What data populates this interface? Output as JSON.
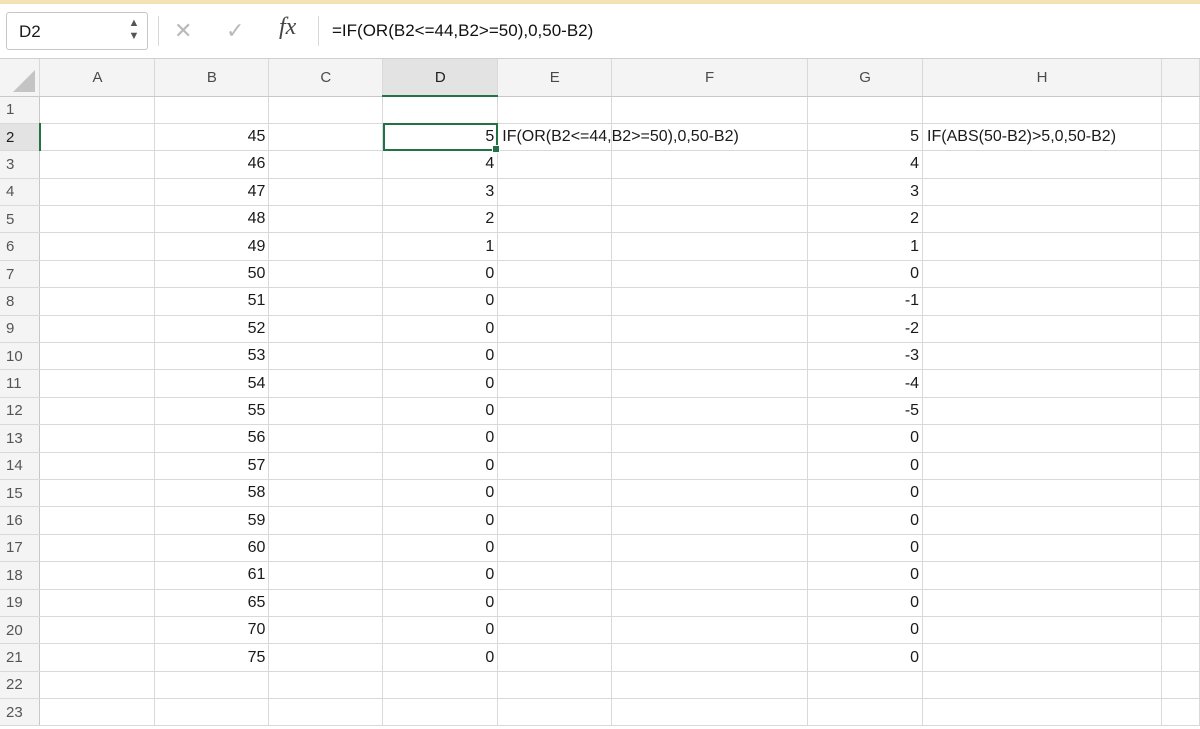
{
  "name_box": "D2",
  "formula_bar": {
    "fx_label": "fx",
    "formula": "=IF(OR(B2<=44,B2>=50),0,50-B2)"
  },
  "columns": [
    "A",
    "B",
    "C",
    "D",
    "E",
    "F",
    "G",
    "H"
  ],
  "selected_cell": "D2",
  "rows": [
    {
      "n": "1",
      "B": "",
      "D": "",
      "E": "",
      "G": "",
      "H": ""
    },
    {
      "n": "2",
      "B": "45",
      "D": "5",
      "E": "IF(OR(B2<=44,B2>=50),0,50-B2)",
      "G": "5",
      "H": "IF(ABS(50-B2)>5,0,50-B2)"
    },
    {
      "n": "3",
      "B": "46",
      "D": "4",
      "E": "",
      "G": "4",
      "H": ""
    },
    {
      "n": "4",
      "B": "47",
      "D": "3",
      "E": "",
      "G": "3",
      "H": ""
    },
    {
      "n": "5",
      "B": "48",
      "D": "2",
      "E": "",
      "G": "2",
      "H": ""
    },
    {
      "n": "6",
      "B": "49",
      "D": "1",
      "E": "",
      "G": "1",
      "H": ""
    },
    {
      "n": "7",
      "B": "50",
      "D": "0",
      "E": "",
      "G": "0",
      "H": ""
    },
    {
      "n": "8",
      "B": "51",
      "D": "0",
      "E": "",
      "G": "-1",
      "H": ""
    },
    {
      "n": "9",
      "B": "52",
      "D": "0",
      "E": "",
      "G": "-2",
      "H": ""
    },
    {
      "n": "10",
      "B": "53",
      "D": "0",
      "E": "",
      "G": "-3",
      "H": ""
    },
    {
      "n": "11",
      "B": "54",
      "D": "0",
      "E": "",
      "G": "-4",
      "H": ""
    },
    {
      "n": "12",
      "B": "55",
      "D": "0",
      "E": "",
      "G": "-5",
      "H": ""
    },
    {
      "n": "13",
      "B": "56",
      "D": "0",
      "E": "",
      "G": "0",
      "H": ""
    },
    {
      "n": "14",
      "B": "57",
      "D": "0",
      "E": "",
      "G": "0",
      "H": ""
    },
    {
      "n": "15",
      "B": "58",
      "D": "0",
      "E": "",
      "G": "0",
      "H": ""
    },
    {
      "n": "16",
      "B": "59",
      "D": "0",
      "E": "",
      "G": "0",
      "H": ""
    },
    {
      "n": "17",
      "B": "60",
      "D": "0",
      "E": "",
      "G": "0",
      "H": ""
    },
    {
      "n": "18",
      "B": "61",
      "D": "0",
      "E": "",
      "G": "0",
      "H": ""
    },
    {
      "n": "19",
      "B": "65",
      "D": "0",
      "E": "",
      "G": "0",
      "H": ""
    },
    {
      "n": "20",
      "B": "70",
      "D": "0",
      "E": "",
      "G": "0",
      "H": ""
    },
    {
      "n": "21",
      "B": "75",
      "D": "0",
      "E": "",
      "G": "0",
      "H": ""
    },
    {
      "n": "22",
      "B": "",
      "D": "",
      "E": "",
      "G": "",
      "H": ""
    },
    {
      "n": "23",
      "B": "",
      "D": "",
      "E": "",
      "G": "",
      "H": ""
    }
  ],
  "colors": {
    "selection": "#217346",
    "header_bg": "#f4f4f4",
    "gridline": "#d9d9d9"
  }
}
